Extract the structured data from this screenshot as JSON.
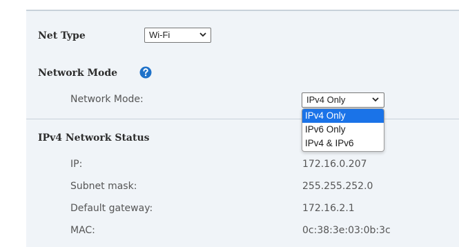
{
  "net_type": {
    "label": "Net Type",
    "value": "Wi-Fi"
  },
  "network_mode_section": {
    "title": "Network Mode",
    "field_label": "Network Mode:",
    "selected": "IPv4 Only",
    "options": [
      "IPv4 Only",
      "IPv6 Only",
      "IPv4 & IPv6"
    ]
  },
  "ipv4_status": {
    "title": "IPv4 Network Status",
    "rows": [
      {
        "label": "IP:",
        "value": "172.16.0.207"
      },
      {
        "label": "Subnet mask:",
        "value": "255.255.252.0"
      },
      {
        "label": "Default gateway:",
        "value": "172.16.2.1"
      },
      {
        "label": "MAC:",
        "value": "0c:38:3e:03:0b:3c"
      }
    ]
  },
  "colors": {
    "panel_bg": "#f0f4f8",
    "help_icon": "#1f72c9",
    "selection": "#1a73e8"
  },
  "icons": [
    "chevron-down-icon",
    "help-icon"
  ]
}
